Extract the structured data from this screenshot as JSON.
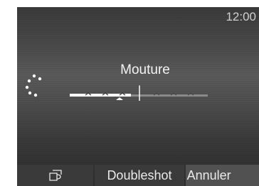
{
  "status": {
    "time": "12:00"
  },
  "setting": {
    "title": "Mouture",
    "level": 0.47
  },
  "softkeys": {
    "left_icon": "cup-icon",
    "doubleshot_label": "Doubleshot",
    "cancel_label": "Annuler"
  },
  "colors": {
    "active": "#ffffff",
    "inactive": "#8a8a8a",
    "background": "#4a4a4a"
  }
}
